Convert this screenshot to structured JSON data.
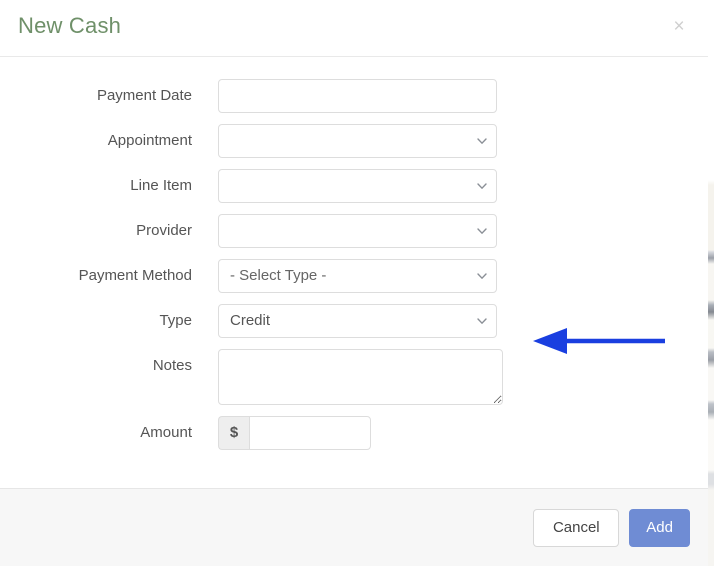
{
  "modal": {
    "title": "New Cash",
    "close_icon": "close-icon",
    "close_label": "×"
  },
  "form": {
    "fields": [
      {
        "label": "Payment Date",
        "type": "text",
        "value": "",
        "placeholder": ""
      },
      {
        "label": "Appointment",
        "type": "select",
        "value": "",
        "icon": "chevron-down-icon"
      },
      {
        "label": "Line Item",
        "type": "select",
        "value": "",
        "icon": "chevron-down-icon"
      },
      {
        "label": "Provider",
        "type": "select",
        "value": "",
        "icon": "chevron-down-icon"
      },
      {
        "label": "Payment Method",
        "type": "select",
        "value": "- Select Type -",
        "icon": "chevron-down-icon",
        "is_placeholder": true,
        "annotated": true
      },
      {
        "label": "Type",
        "type": "select",
        "value": "Credit",
        "icon": "chevron-down-icon"
      },
      {
        "label": "Notes",
        "type": "textarea",
        "value": "",
        "placeholder": ""
      },
      {
        "label": "Amount",
        "type": "currency",
        "prefix": "$",
        "value": "",
        "placeholder": ""
      }
    ]
  },
  "annotation": {
    "name": "blue-arrow-annotation",
    "points_to": "Payment Method",
    "color": "#1a3fe0",
    "direction": "left"
  },
  "footer": {
    "cancel_label": "Cancel",
    "submit_label": "Add"
  },
  "colors": {
    "title": "#6f9069",
    "primary_button": "#6f8cd4",
    "annotation_arrow": "#1a3fe0",
    "field_border": "#dddddd",
    "footer_bg": "#f7f7f7"
  }
}
